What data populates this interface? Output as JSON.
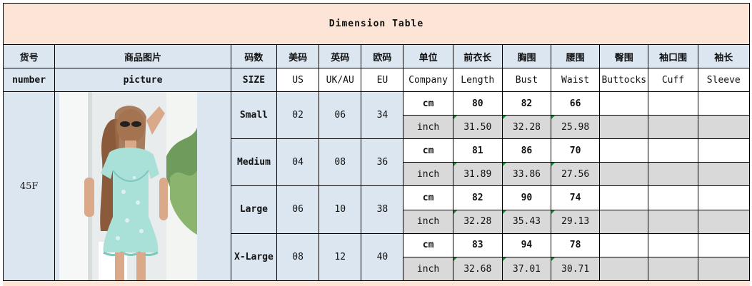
{
  "title": "Dimension Table",
  "headers_cn": [
    "货号",
    "商品图片",
    "码数",
    "美码",
    "英码",
    "欧码",
    "单位",
    "前衣长",
    "胸围",
    "腰围",
    "臀围",
    "袖口围",
    "袖长"
  ],
  "headers_en": [
    "number",
    "picture",
    "SIZE",
    "US",
    "UK/AU",
    "EU",
    "Company",
    "Length",
    "Bust",
    "Waist",
    "Buttocks",
    "Cuff",
    "Sleeve"
  ],
  "item_number": "45F",
  "photo_icon": "model-photo-icon",
  "rows": [
    {
      "size": "Small",
      "us": "02",
      "uk": "06",
      "eu": "34",
      "cm": {
        "unit": "cm",
        "length": "80",
        "bust": "82",
        "waist": "66"
      },
      "inch": {
        "unit": "inch",
        "length": "31.50",
        "bust": "32.28",
        "waist": "25.98"
      }
    },
    {
      "size": "Medium",
      "us": "04",
      "uk": "08",
      "eu": "36",
      "cm": {
        "unit": "cm",
        "length": "81",
        "bust": "86",
        "waist": "70"
      },
      "inch": {
        "unit": "inch",
        "length": "31.89",
        "bust": "33.86",
        "waist": "27.56"
      }
    },
    {
      "size": "Large",
      "us": "06",
      "uk": "10",
      "eu": "38",
      "cm": {
        "unit": "cm",
        "length": "82",
        "bust": "90",
        "waist": "74"
      },
      "inch": {
        "unit": "inch",
        "length": "32.28",
        "bust": "35.43",
        "waist": "29.13"
      }
    },
    {
      "size": "X-Large",
      "us": "08",
      "uk": "12",
      "eu": "40",
      "cm": {
        "unit": "cm",
        "length": "83",
        "bust": "94",
        "waist": "78"
      },
      "inch": {
        "unit": "inch",
        "length": "32.68",
        "bust": "37.01",
        "waist": "30.71"
      }
    }
  ],
  "colors": {
    "title_bg": "#fce4d6",
    "header_bg": "#dce6f1",
    "inch_bg": "#d9d9d9",
    "mark": "#1e8a3c"
  }
}
